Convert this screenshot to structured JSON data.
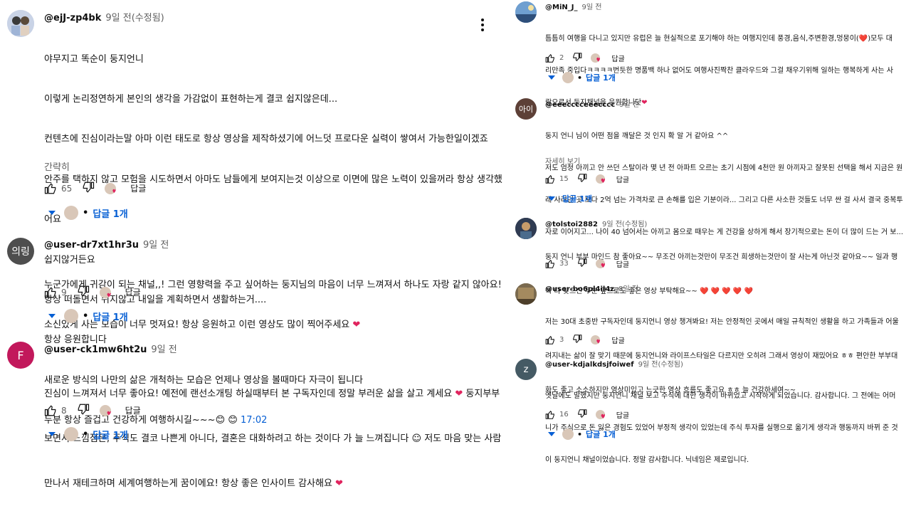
{
  "left": [
    {
      "handle": "@ejJ-zp4bk",
      "time": "9일 전(수정됨)",
      "avatar": {
        "type": "photo",
        "bg": "#c9d3e6"
      },
      "lines": [
        "야무지고 똑순이 둥지언니",
        "이렇게 논리정연하게 본인의 생각을 가감없이 표현하는게 결코 쉽지않은데...",
        "컨텐츠에 진심이라는말 아마 이런 태도로 항상 영상을 제작하셨기에 어느덧 프로다운 실력이 쌓여서 가능한일이겠죠",
        "안주를 택하지 않고 모험을 시도하면서 아마도 남들에게 보여지는것 이상으로 이면에 많은 노력이 있을꺼라 항상 생각했",
        "어요",
        "쉽지않거든요",
        "항상 떠돌면서 쉬지않고 내일을 계획하면서 생활하는거....",
        "항상 응원합니다",
        "새로운 방식의 나만의 삶은 개척하는 모습은 언제나 영상을 볼때마다 자극이 됩니다",
        "두분 항상  즐겁고 건강하게 여행하시길~~~😊 😊"
      ],
      "timestamp_link": "17:02",
      "read_less": "간략히",
      "likes": "65",
      "reply_label": "답글",
      "replies_label": "답글 1개"
    },
    {
      "handle": "@user-dr7xt1hr3u",
      "time": "9일 전",
      "avatar": {
        "type": "text",
        "text": "의링",
        "bg": "#4e4e4e"
      },
      "lines": [
        "누군가에게 귀감이 되는 채널,,! 그런 영향력을 주고 싶어하는 둥지님의 마음이 너무 느껴져서 하나도 자랑 같지 않아요!",
        "소신있게 사는 모습이 너무 멋져요! 항상 응원하고 이런 영상도 많이 찍어주세요"
      ],
      "likes": "9",
      "reply_label": "답글",
      "replies_label": "답글 1개"
    },
    {
      "handle": "@user-ck1mw6ht2u",
      "time": "9일 전",
      "avatar": {
        "type": "text",
        "text": "F",
        "bg": "#c2185b"
      },
      "lines": [
        "진심이 느껴져서 너무 좋아요! 예전에 랜선소개팅 하실때부터 본 구독자인데 정말 부러운 삶을 살고 계세요",
        "보면서 느낌점은, 주식도 결코 나쁜게 아니다, 결혼은 대화하려고 하는 것이다 가 늘 느껴집니다",
        "만나서 재테크하며 세계여행하는게 꿈이에요! 항상 좋은 인사이트 감사해요"
      ],
      "line_suffix": [
        "둥지부부",
        "저도 마음 맞는 사람"
      ],
      "likes": "8",
      "reply_label": "답글",
      "replies_label": "답글 1개"
    }
  ],
  "right": [
    {
      "handle": "@MiN_J_",
      "time": "9일 전",
      "avatar": {
        "type": "photo",
        "bg": "#6f9fd0"
      },
      "lines": [
        "틈틈히 여행을 다니고 있지만 유럽은 늘 현실적으로 포기해야 하는 여행지인데  풍경,음식,주변환경,멍뭉이(❤️)모두 대",
        "리만족 중입다ㅋㅋㅋㅋ번듯한 명품백 하나 없어도 여행사진짝찬 클라우드와 그걸 채우기위해 일하는 행복하게 사는 사",
        "람으로서 둥지채널을 응원합니닷"
      ],
      "likes": "2",
      "reply_label": "답글",
      "replies_label": "답글 1개"
    },
    {
      "handle": "@eeecccceeecccc",
      "time": "9일 전",
      "avatar": {
        "type": "text",
        "text": "아이",
        "bg": "#5d4037"
      },
      "lines": [
        "둥지 언니 님이 어떤 점을 깨달은 것 인지 확 알 거 같아요 ^^",
        "저도 엄청 아끼고 안 쓰던 스탈이라 몇 년 전 아파트 오르는 초기 시점에 4천만 원 아끼자고 잘못된 선택을 해서 지금은 원",
        "래 사려던 곳 보다 2억 넘는 가격차로 큰 손해를 입은 기분이라... 그리고 다른 사소한 것들도 너무 싼 걸 사서 결국 중복투",
        "자로 이어지고... 나이 40 넘어서는 아끼고 몸으로 때우는 게 건강을 상하게 해서 장기적으로는 돈이 더 많이 드는 거 보..."
      ],
      "read_more": "자세히 보기",
      "likes": "15",
      "reply_label": "답글",
      "replies_label": "답글 1개"
    },
    {
      "handle": "@tolstoi2882",
      "time": "9일 전(수정됨)",
      "avatar": {
        "type": "photo",
        "bg": "#2f3b52"
      },
      "lines": [
        "둥지 언니 부부 마인드 참 좋아요~~  무조건 아끼는것만이 무조건 희생하는것만이  잘 사는게 아닌것 같아요~~ 일과 행",
        "복 다 찾으신 두분 앞으로도 좋은 영상 부탁해요~~ ❤️ ❤️ ❤️ ❤️ ❤️"
      ],
      "likes": "33",
      "reply_label": "답글"
    },
    {
      "handle": "@user-bo6pl4il4z",
      "time": "8일 전",
      "avatar": {
        "type": "photo",
        "bg": "#7a6a4f"
      },
      "lines": [
        "저는 30대 초중반 구독자인데 둥지언니 영상 챙겨봐요! 저는 안정적인 곳에서 매일 규칙적인 생활을 하고 가족들과 어울",
        "려지내는 삶이 잘 맞기 때문에 둥지언니와 라이프스타일은 다르지만 오히려 그래서 영상이 재밌어요 ㅎㅎ 편안한 부부대",
        "화도 좋고 소소하지만 영상미있고 느긋한 영상 흐름도 좋고요 ㅎㅎ 늘 건강하세여~~"
      ],
      "likes": "3",
      "reply_label": "답글"
    },
    {
      "handle": "@user-kdjalkdsjfoiwef",
      "time": "9일 전(수정됨)",
      "avatar": {
        "type": "text",
        "text": "z",
        "bg": "#455a64"
      },
      "lines": [
        "옛날에도 말했지만 둥지언니 채널 보고 주식에 대한 생각이 바뀌었고 시작하게 되었습니다. 감사합니다. 그 전에는 어머",
        "니가 주식으로 돈 잃은 경험도 있었어 부정적 생각이 있었는데 주식 투자를 실행으로 옮기게 생각과 행동까지 바뀌 준 것",
        "이 둥지언니 채널이었습니다. 정말 감사합니다. 닉네임은 제로입니다."
      ],
      "likes": "16",
      "reply_label": "답글",
      "replies_label": "답글 1개"
    }
  ],
  "colors": {
    "link": "#065fd4",
    "heart": "#e0245e",
    "meta": "#606060"
  }
}
